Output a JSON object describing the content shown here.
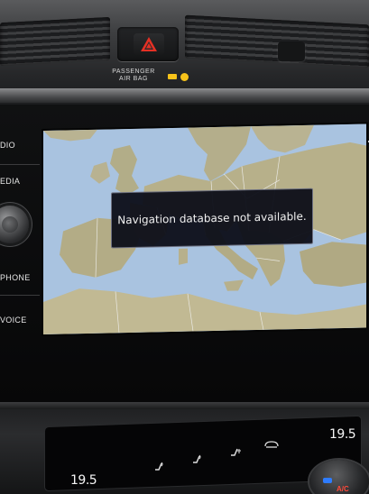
{
  "dashboard": {
    "airbag_label_line1": "PASSENGER",
    "airbag_label_line2": "AIR BAG"
  },
  "side_menu": {
    "items": [
      "DIO",
      "EDIA",
      "PHONE",
      "VOICE"
    ]
  },
  "map": {
    "message": "Navigation database not available."
  },
  "climate": {
    "left_temp": "19.5",
    "right_temp": "19.5",
    "ac_label": "A/C"
  },
  "colors": {
    "hazard": "#e53024",
    "airbag_indicator": "#f6c21a",
    "sea": "#a9c3e0",
    "land": "#b7b08a",
    "dialog_bg": "#0c0e18"
  },
  "icons": [
    "hazard-triangle-icon",
    "seat-heat-icon",
    "seat-heat-icon",
    "seat-vent-icon",
    "recirculation-icon"
  ]
}
